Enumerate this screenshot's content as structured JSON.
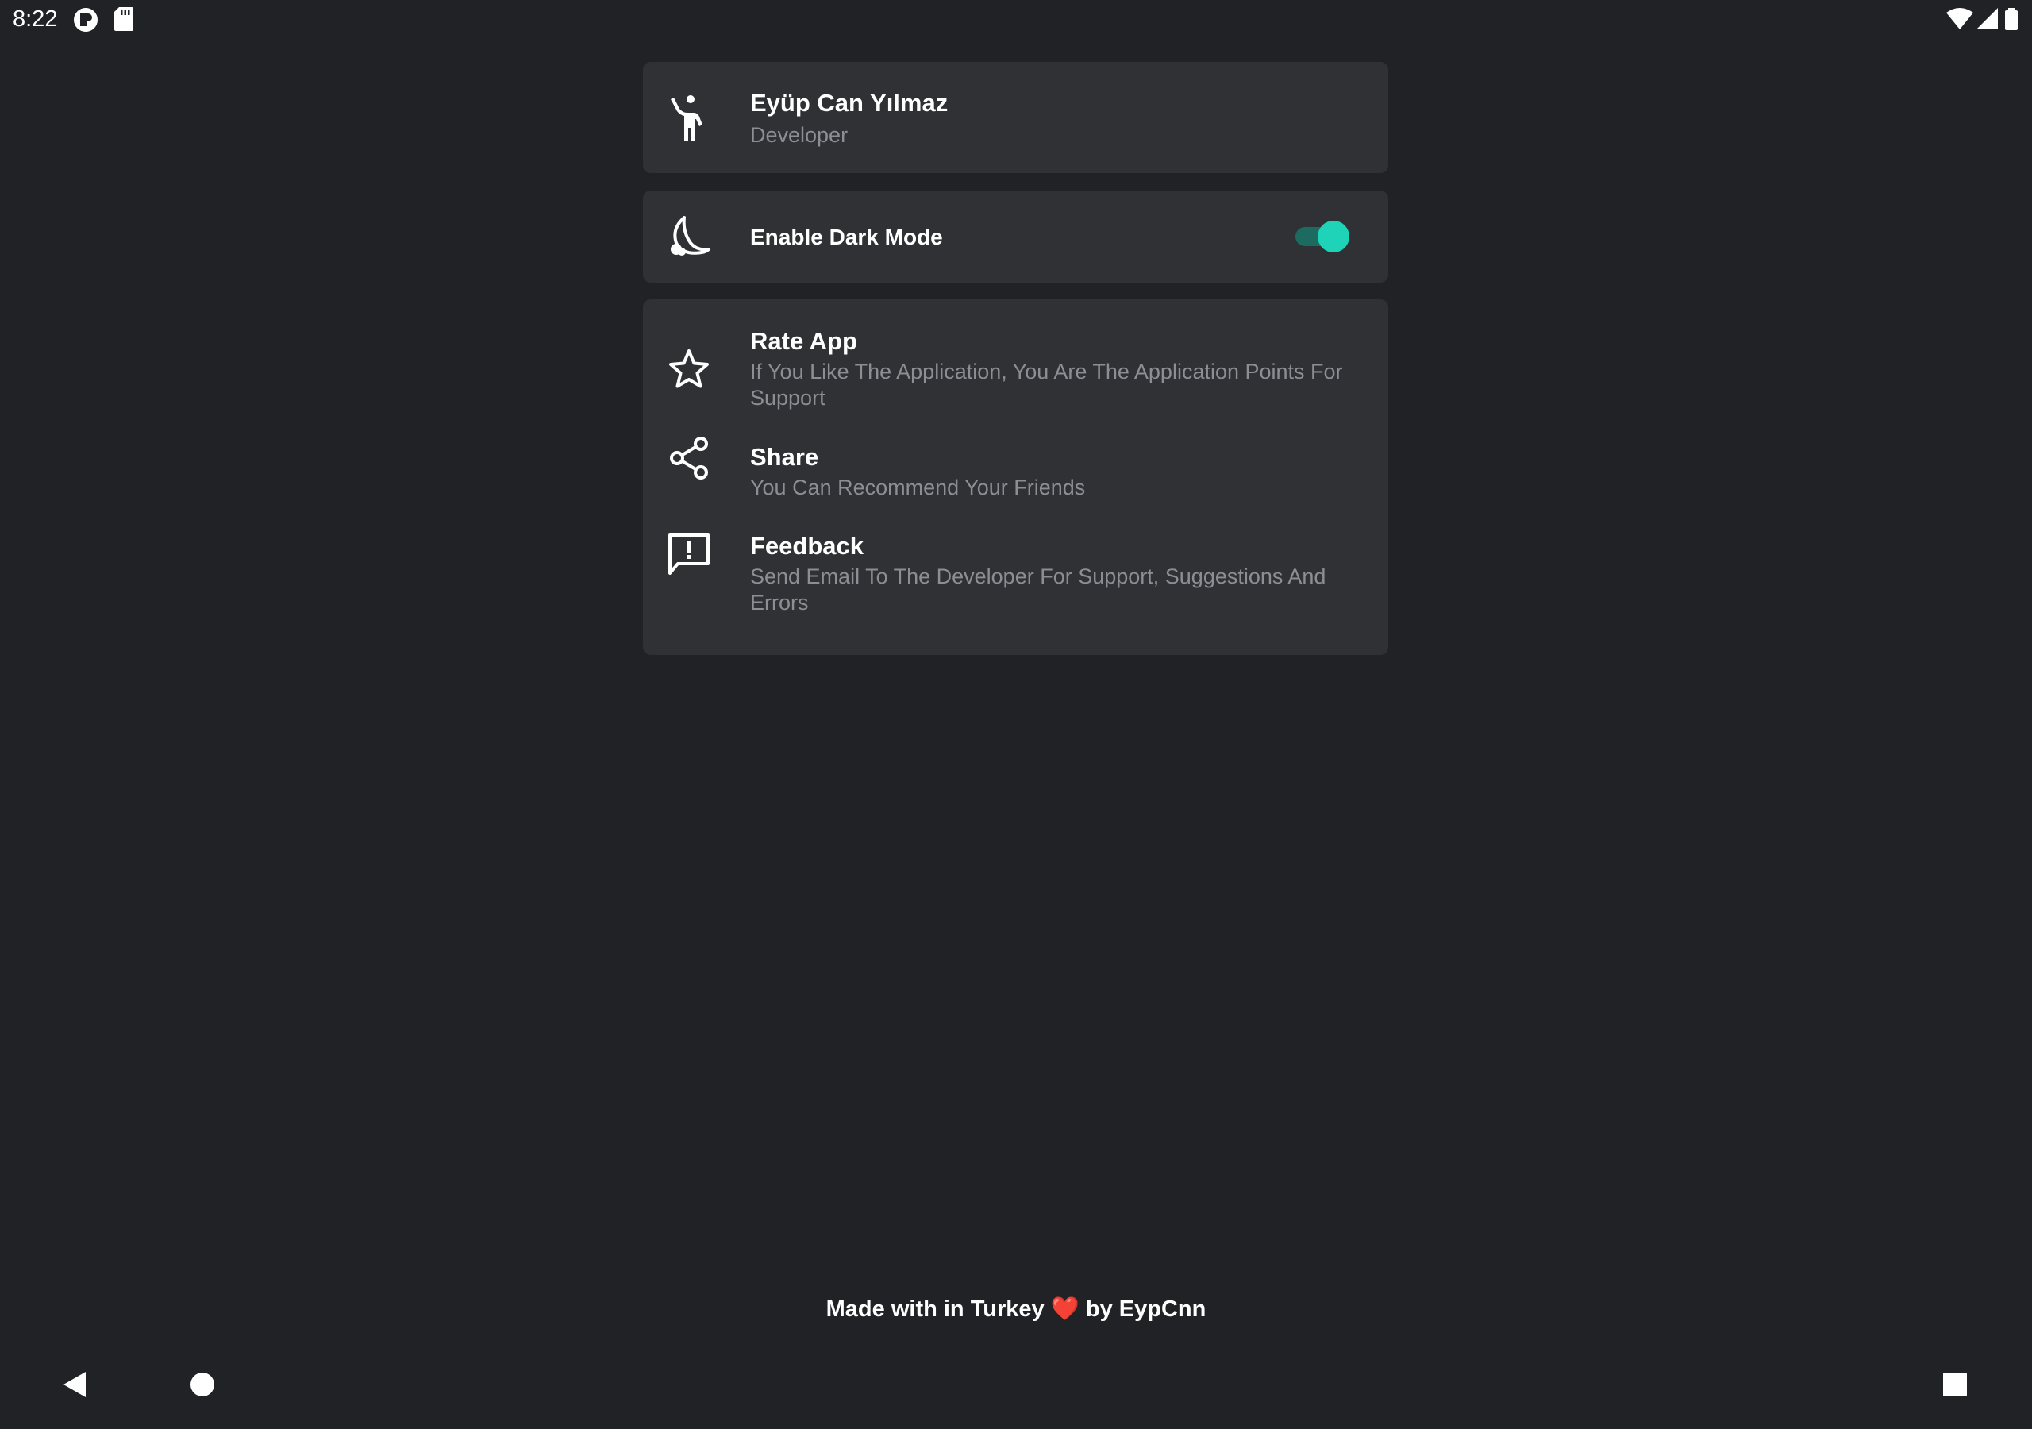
{
  "status_bar": {
    "time": "8:22",
    "left_icons": [
      "pcloud-icon",
      "sd-card-icon"
    ],
    "right_icons": [
      "wifi-icon",
      "signal-icon",
      "battery-icon"
    ]
  },
  "profile": {
    "icon": "person-icon",
    "name": "Eyüp Can Yılmaz",
    "role": "Developer"
  },
  "dark_mode": {
    "icon": "moon-icon",
    "label": "Enable Dark Mode",
    "enabled": true
  },
  "links": [
    {
      "icon": "star-icon",
      "title": "Rate App",
      "subtitle": "If You Like The Application, You Are The Application Points For Support"
    },
    {
      "icon": "share-icon",
      "title": "Share",
      "subtitle": "You Can Recommend Your Friends"
    },
    {
      "icon": "feedback-icon",
      "title": "Feedback",
      "subtitle": "Send Email To The Developer For Support, Suggestions And Errors"
    }
  ],
  "footer": {
    "before": "Made with in Turkey",
    "heart": "❤️",
    "after": "by EypCnn"
  },
  "nav_bar": [
    "back-icon",
    "home-icon",
    "recents-icon"
  ],
  "colors": {
    "background": "#212226",
    "card": "#303135",
    "accent": "#1ed3b8",
    "subtitle": "#8d8e93"
  }
}
